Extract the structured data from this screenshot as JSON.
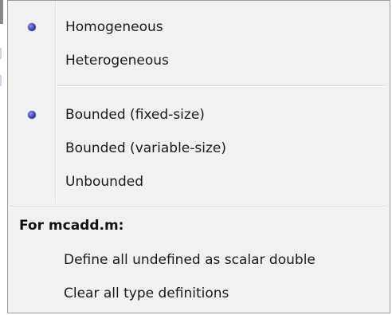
{
  "menu": {
    "items": [
      {
        "label": "Homogeneous",
        "checked": true
      },
      {
        "label": "Heterogeneous",
        "checked": false
      },
      {
        "label": "Bounded (fixed-size)",
        "checked": true
      },
      {
        "label": "Bounded (variable-size)",
        "checked": false
      },
      {
        "label": "Unbounded",
        "checked": false
      }
    ],
    "section_header": "For mcadd.m:",
    "actions": [
      {
        "label": "Define all undefined as scalar double"
      },
      {
        "label": "Clear all type definitions"
      }
    ]
  },
  "icons": {
    "radio_bullet": "radio-selected-bullet-icon"
  },
  "colors": {
    "menu_background": "#f1f1f1",
    "menu_border": "#9a9a9a",
    "bullet": "#3b3fb0",
    "text": "#1a1a1a"
  }
}
